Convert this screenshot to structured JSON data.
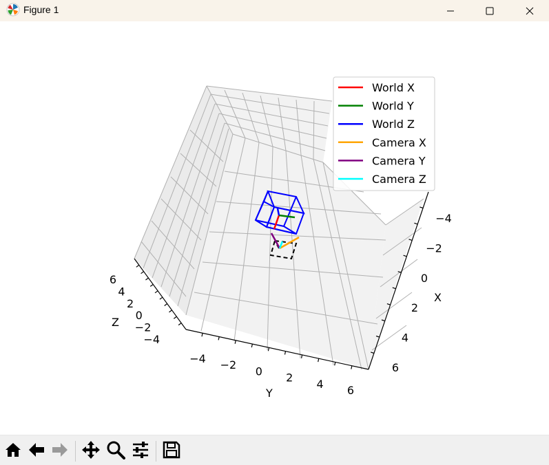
{
  "window": {
    "title": "Figure 1",
    "minimize_label": "minimize",
    "maximize_label": "maximize",
    "close_label": "close"
  },
  "icons": {
    "app": "matplotlib-icon",
    "minimize": "minimize-icon",
    "maximize": "maximize-icon",
    "close": "close-icon"
  },
  "toolbar": {
    "tools": [
      {
        "name": "home-button",
        "icon": "home-icon"
      },
      {
        "name": "back-button",
        "icon": "arrow-left-icon"
      },
      {
        "name": "forward-button",
        "icon": "arrow-right-icon"
      },
      {
        "name": "pan-button",
        "icon": "move-icon"
      },
      {
        "name": "zoom-button",
        "icon": "magnifier-icon"
      },
      {
        "name": "configure-subplots-button",
        "icon": "sliders-icon"
      },
      {
        "name": "save-button",
        "icon": "floppy-disk-icon"
      }
    ]
  },
  "chart_data": {
    "type": "line",
    "projection": "3d",
    "title": "",
    "axes": {
      "x": {
        "label": "X",
        "ticks": [
          "−4",
          "−2",
          "0",
          "2",
          "4",
          "6"
        ],
        "lim": [
          -5,
          7
        ]
      },
      "y": {
        "label": "Y",
        "ticks": [
          "−4",
          "−2",
          "0",
          "2",
          "4",
          "6"
        ],
        "lim": [
          -5,
          7
        ]
      },
      "z": {
        "label": "Z",
        "ticks": [
          "−4",
          "−2",
          "0",
          "2",
          "4",
          "6"
        ],
        "lim": [
          -5,
          7
        ]
      }
    },
    "grid": true,
    "legend": {
      "placement": "upper-right",
      "entries": [
        {
          "label": "World X",
          "color": "#ff0000"
        },
        {
          "label": "World Y",
          "color": "#008000"
        },
        {
          "label": "World Z",
          "color": "#0000ff"
        },
        {
          "label": "Camera X",
          "color": "#ffa500"
        },
        {
          "label": "Camera Y",
          "color": "#800080"
        },
        {
          "label": "Camera Z",
          "color": "#00ffff"
        }
      ]
    },
    "objects": [
      {
        "name": "world-cube",
        "color": "#0000ff",
        "style": "solid"
      },
      {
        "name": "camera-frustum",
        "color": "#000000",
        "style": "dashed"
      }
    ]
  }
}
